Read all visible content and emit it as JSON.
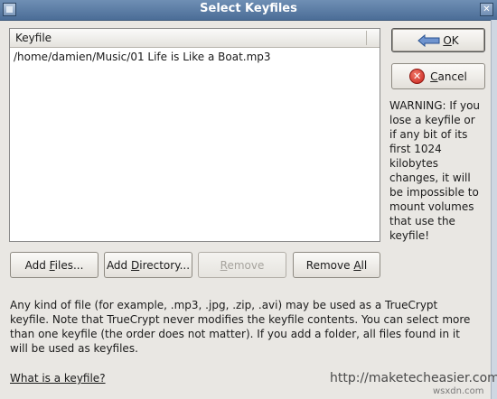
{
  "window": {
    "title": "Select Keyfiles"
  },
  "list": {
    "header": "Keyfile",
    "rows": [
      "/home/damien/Music/01 Life is Like a Boat.mp3"
    ]
  },
  "buttons": {
    "ok": {
      "pre": "",
      "mnemonic": "O",
      "post": "K"
    },
    "cancel": {
      "pre": "",
      "mnemonic": "C",
      "post": "ancel"
    },
    "add_files": {
      "pre": "Add ",
      "mnemonic": "F",
      "post": "iles..."
    },
    "add_directory": {
      "pre": "Add ",
      "mnemonic": "D",
      "post": "irectory..."
    },
    "remove": {
      "pre": "",
      "mnemonic": "R",
      "post": "emove",
      "enabled": false
    },
    "remove_all": {
      "pre": "Remove ",
      "mnemonic": "A",
      "post": "ll"
    }
  },
  "warning_text": "WARNING: If you lose a keyfile or if any bit of its first 1024 kilobytes changes, it will be impossible to mount volumes that use the keyfile!",
  "description_text": "Any kind of file (for example, .mp3, .jpg, .zip, .avi) may be used as a TrueCrypt keyfile. Note that TrueCrypt never modifies the keyfile contents. You can select more than one keyfile (the order does not matter). If you add a folder, all files found in it will be used as keyfiles.",
  "help_link": "What is a keyfile?",
  "footer_site": "http://maketecheasier.com",
  "watermark": "wsxdn.com",
  "icons": {
    "ok": "arrow-left-icon",
    "cancel": "cancel-x-icon",
    "app": "window-icon",
    "close": "close-icon"
  }
}
